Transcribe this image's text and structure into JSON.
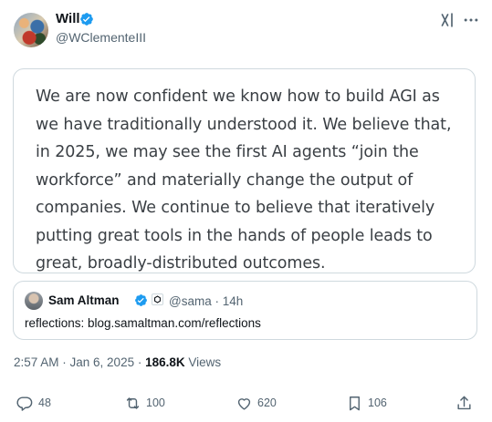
{
  "author": {
    "name": "Will",
    "handle": "@WClementeIII",
    "avatar_icon": "avatar-collage"
  },
  "header_actions": {
    "grok_icon": "grok-icon",
    "more_icon": "more-horizontal-icon"
  },
  "image_card": {
    "text": "We are now confident we know how to build AGI as we have traditionally understood it. We believe that, in 2025, we may see the first AI agents “join the workforce” and materially change the output of companies. We continue to believe that iteratively putting great tools in the hands of people leads to great, broadly-distributed outcomes."
  },
  "quoted_post": {
    "name": "Sam Altman",
    "meta": "@sama · 14h",
    "text": "reflections: blog.samaltman.com/reflections"
  },
  "post_meta": {
    "time": "2:57 AM · Jan 6, 2025 · ",
    "views_count": "186.8K",
    "views_label": " Views"
  },
  "actions": {
    "replies": "48",
    "reposts": "100",
    "likes": "620",
    "bookmarks": "106"
  },
  "colors": {
    "accent": "#1d9bf0",
    "muted": "#536471",
    "border": "#cfd9de"
  }
}
